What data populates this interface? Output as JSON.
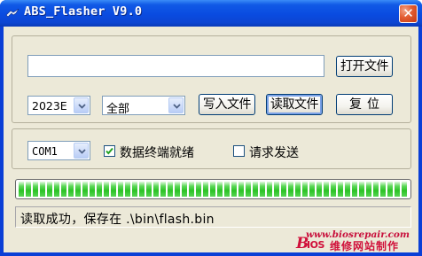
{
  "window": {
    "title": "ABS_Flasher V9.0"
  },
  "file": {
    "path_value": "",
    "open_label": "打开文件"
  },
  "options": {
    "year_value": "2023E",
    "range_value": "全部"
  },
  "actions": {
    "write_label": "写入文件",
    "read_label": "读取文件",
    "reset_label": "复位"
  },
  "connection": {
    "port_value": "COM1",
    "ready_label": "数据终端就绪",
    "ready_checked": true,
    "request_label": "请求发送",
    "request_checked": false
  },
  "progress": {
    "fraction": 1.0
  },
  "status": {
    "text": "读取成功，保存在 .\\bin\\flash.bin"
  },
  "watermark": {
    "url": "www.biosrepair.com",
    "brand_b": "B",
    "brand_ios": "IOS",
    "brand_cn": "维修网站制作"
  }
}
